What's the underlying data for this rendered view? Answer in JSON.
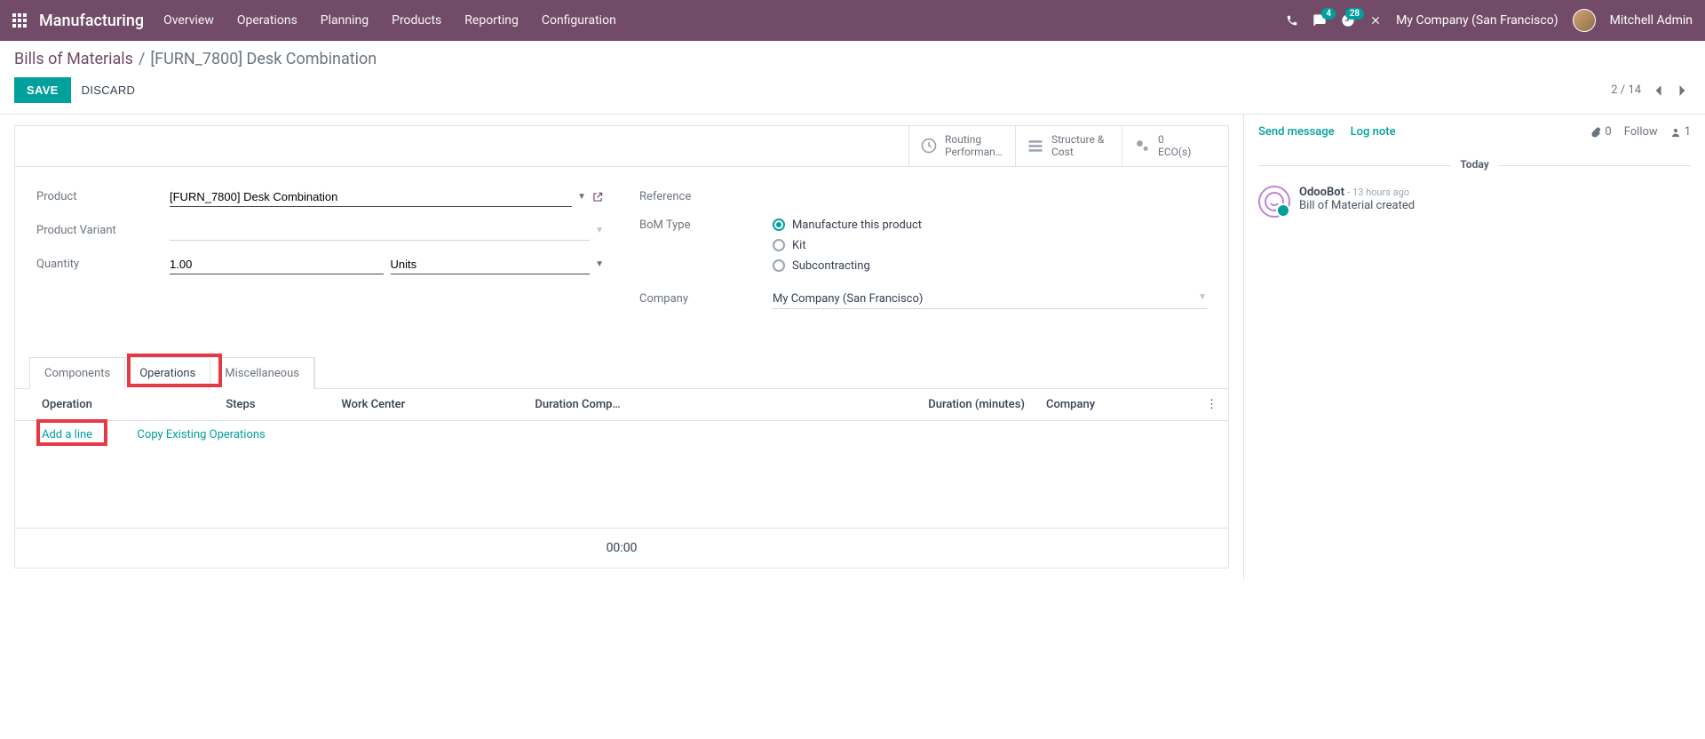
{
  "nav": {
    "brand": "Manufacturing",
    "items": [
      "Overview",
      "Operations",
      "Planning",
      "Products",
      "Reporting",
      "Configuration"
    ],
    "msg_badge": "4",
    "clock_badge": "28",
    "company": "My Company (San Francisco)",
    "user": "Mitchell Admin"
  },
  "breadcrumb": {
    "root": "Bills of Materials",
    "sep": "/",
    "current": "[FURN_7800] Desk Combination"
  },
  "actions": {
    "save": "SAVE",
    "discard": "DISCARD"
  },
  "pager": {
    "text": "2 / 14"
  },
  "statbuttons": {
    "routing": {
      "l1": "Routing",
      "l2": "Performan…"
    },
    "structure": {
      "l1": "Structure &",
      "l2": "Cost"
    },
    "ecos": {
      "l1": "0",
      "l2": "ECO(s)"
    }
  },
  "form": {
    "labels": {
      "product": "Product",
      "product_variant": "Product Variant",
      "quantity": "Quantity",
      "reference": "Reference",
      "bom_type": "BoM Type",
      "company": "Company"
    },
    "product_value": "[FURN_7800] Desk Combination",
    "qty_value": "1.00",
    "uom_value": "Units",
    "bom_options": [
      "Manufacture this product",
      "Kit",
      "Subcontracting"
    ],
    "bom_selected": 0,
    "company_value": "My Company (San Francisco)"
  },
  "tabs": {
    "items": [
      "Components",
      "Operations",
      "Miscellaneous"
    ],
    "active": 1
  },
  "optable": {
    "headers": [
      "Operation",
      "Steps",
      "Work Center",
      "Duration Comp…",
      "Duration (minutes)",
      "Company"
    ],
    "add_line": "Add a line",
    "copy_ops": "Copy Existing Operations",
    "footer_total": "00:00"
  },
  "chatter": {
    "send": "Send message",
    "log": "Log note",
    "attach_count": "0",
    "follow": "Follow",
    "followers": "1",
    "today": "Today",
    "msg_author": "OdooBot",
    "msg_time": "- 13 hours ago",
    "msg_text": "Bill of Material created"
  }
}
